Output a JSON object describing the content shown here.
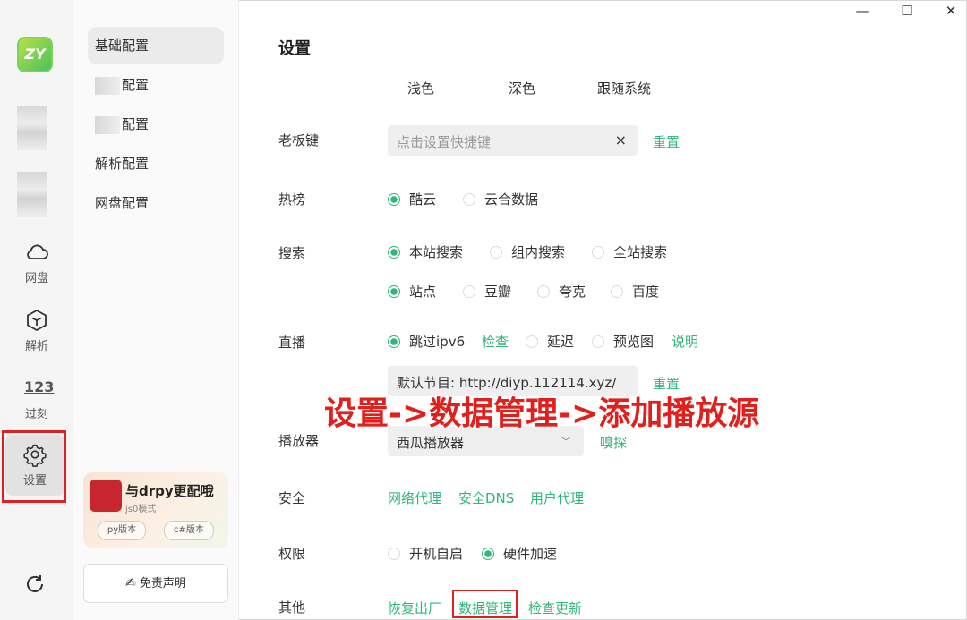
{
  "window": {
    "minimize": "—",
    "maximize": "☐",
    "close": "✕"
  },
  "rail": {
    "logo_text": "ZY",
    "items": [
      {
        "label": "网盘",
        "icon": "cloud-icon"
      },
      {
        "label": "解析",
        "icon": "cube-icon"
      },
      {
        "label": "过刻",
        "icon": "numbers-icon",
        "icon_text": "123"
      },
      {
        "label": "设置",
        "icon": "gear-icon"
      }
    ]
  },
  "menu": {
    "items": [
      {
        "label": "基础配置"
      },
      {
        "label": "配置"
      },
      {
        "label": "配置"
      },
      {
        "label": "解析配置"
      },
      {
        "label": "网盘配置"
      }
    ],
    "promo": {
      "title": "与drpy更配哦",
      "subtitle": "js0模式",
      "pill1": "py版本",
      "pill2": "c#版本"
    },
    "disclaimer": "免责声明"
  },
  "main": {
    "title": "设置",
    "theme": {
      "light": "浅色",
      "dark": "深色",
      "system": "跟随系统"
    },
    "boss_key": {
      "label": "老板键",
      "placeholder": "点击设置快捷键",
      "clear": "×",
      "reset": "重置"
    },
    "hot": {
      "label": "热榜",
      "opt1": "酷云",
      "opt2": "云合数据"
    },
    "search": {
      "label": "搜索",
      "scope1": "本站搜索",
      "scope2": "组内搜索",
      "scope3": "全站搜索",
      "src1": "站点",
      "src2": "豆瓣",
      "src3": "夸克",
      "src4": "百度"
    },
    "live": {
      "label": "直播",
      "skip_ipv6": "跳过ipv6",
      "check": "检查",
      "delay": "延迟",
      "preview": "预览图",
      "explain": "说明",
      "default_program": "默认节目: http://diyp.112114.xyz/",
      "reset": "重置"
    },
    "player": {
      "label": "播放器",
      "value": "西瓜播放器",
      "sniff": "嗅探"
    },
    "security": {
      "label": "安全",
      "proxy": "网络代理",
      "dns": "安全DNS",
      "ua": "用户代理"
    },
    "permission": {
      "label": "权限",
      "autostart": "开机自启",
      "hw_accel": "硬件加速"
    },
    "other": {
      "label": "其他",
      "factory_reset": "恢复出厂",
      "data_manage": "数据管理",
      "check_update": "检查更新"
    }
  },
  "annotation": {
    "text": "设置->数据管理->添加播放源"
  },
  "colors": {
    "accent": "#2fb67a",
    "highlight_red": "#e02020"
  }
}
